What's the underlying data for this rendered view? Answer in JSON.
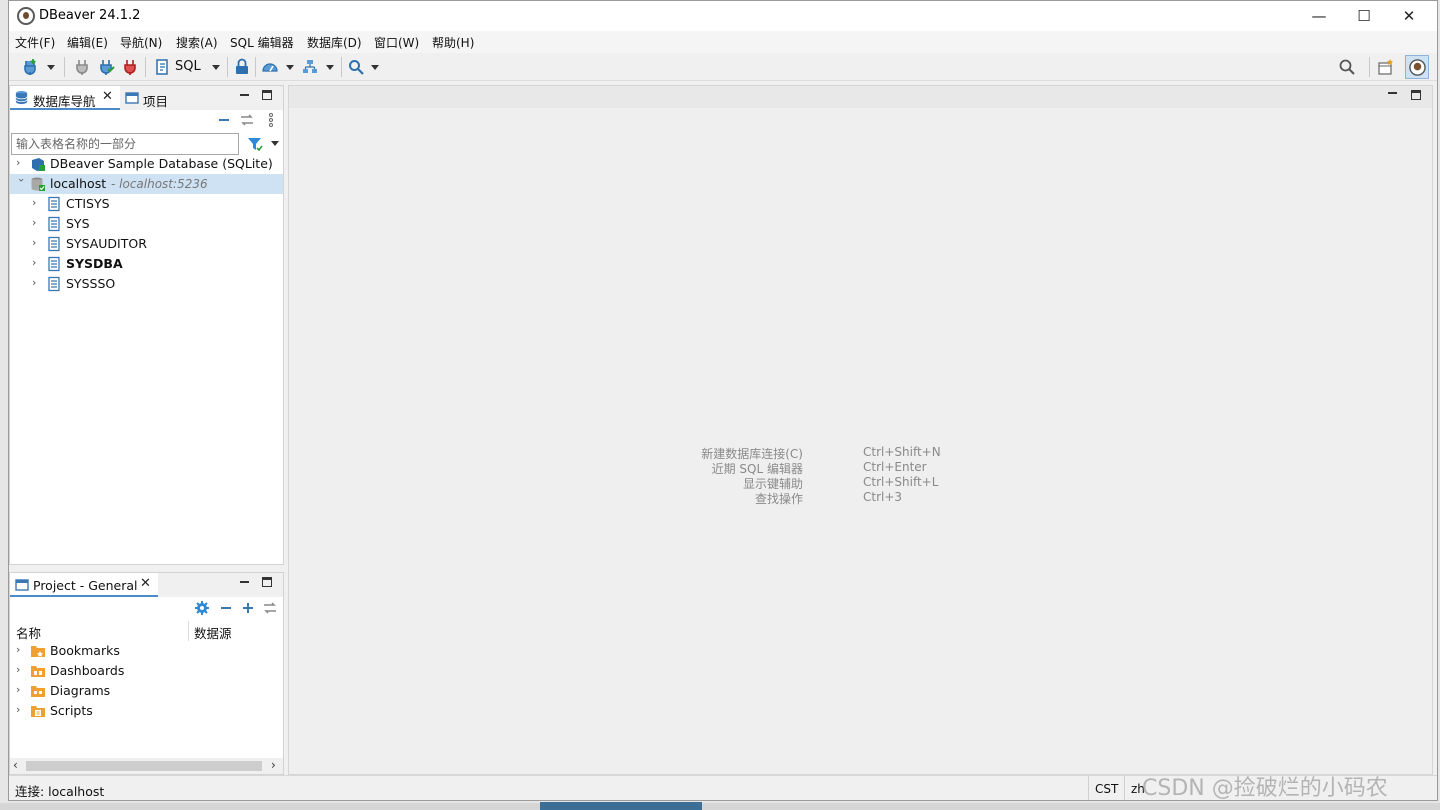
{
  "window": {
    "title": "DBeaver 24.1.2",
    "controls": {
      "minimize": "—",
      "maximize": "☐",
      "close": "✕"
    }
  },
  "menubar": {
    "items": [
      "文件(F)",
      "编辑(E)",
      "导航(N)",
      "搜索(A)",
      "SQL 编辑器",
      "数据库(D)",
      "窗口(W)",
      "帮助(H)"
    ]
  },
  "toolbar": {
    "sql_label": "SQL",
    "icons": [
      "new-connection-icon",
      "disconnect-icon",
      "connect-icon",
      "disconnect-all-icon",
      "sql-editor-icon",
      "lock-icon",
      "dashboard-icon",
      "navigator-icon",
      "search-icon",
      "global-search-icon",
      "perspective-icon",
      "dbeaver-perspective-icon"
    ]
  },
  "navigator": {
    "tab_label": "数据库导航",
    "tab2_label": "项目",
    "filter_placeholder": "输入表格名称的一部分",
    "tree": [
      {
        "label": "DBeaver Sample Database (SQLite)",
        "sub": "",
        "level": 0,
        "expanded": false,
        "icon": "sqlite-db-icon"
      },
      {
        "label": "localhost",
        "sub": "- localhost:5236",
        "level": 0,
        "expanded": true,
        "selected": true,
        "icon": "db-connection-icon"
      },
      {
        "label": "CTISYS",
        "level": 1,
        "icon": "schema-icon"
      },
      {
        "label": "SYS",
        "level": 1,
        "icon": "schema-icon"
      },
      {
        "label": "SYSAUDITOR",
        "level": 1,
        "icon": "schema-icon"
      },
      {
        "label": "SYSDBA",
        "level": 1,
        "bold": true,
        "icon": "schema-icon"
      },
      {
        "label": "SYSSSO",
        "level": 1,
        "icon": "schema-icon"
      }
    ]
  },
  "project": {
    "tab_label": "Project - General",
    "col_name": "名称",
    "col_source": "数据源",
    "items": [
      {
        "label": "Bookmarks",
        "icon": "bookmarks-folder-icon"
      },
      {
        "label": "Dashboards",
        "icon": "dashboards-folder-icon"
      },
      {
        "label": "Diagrams",
        "icon": "diagrams-folder-icon"
      },
      {
        "label": "Scripts",
        "icon": "scripts-folder-icon"
      }
    ]
  },
  "editor": {
    "hints": [
      {
        "label": "新建数据库连接(C)",
        "keys": "Ctrl+Shift+N"
      },
      {
        "label": "近期 SQL 编辑器",
        "keys": "Ctrl+Enter"
      },
      {
        "label": "显示键辅助",
        "keys": "Ctrl+Shift+L"
      },
      {
        "label": "查找操作",
        "keys": "Ctrl+3"
      }
    ]
  },
  "statusbar": {
    "text": "连接: localhost",
    "timezone": "CST",
    "locale": "zh"
  },
  "watermark": "CSDN @捡破烂的小码农",
  "colors": {
    "selection": "#cfe2f3",
    "accent_blue": "#3a78b5",
    "folder_orange": "#f0a030"
  }
}
